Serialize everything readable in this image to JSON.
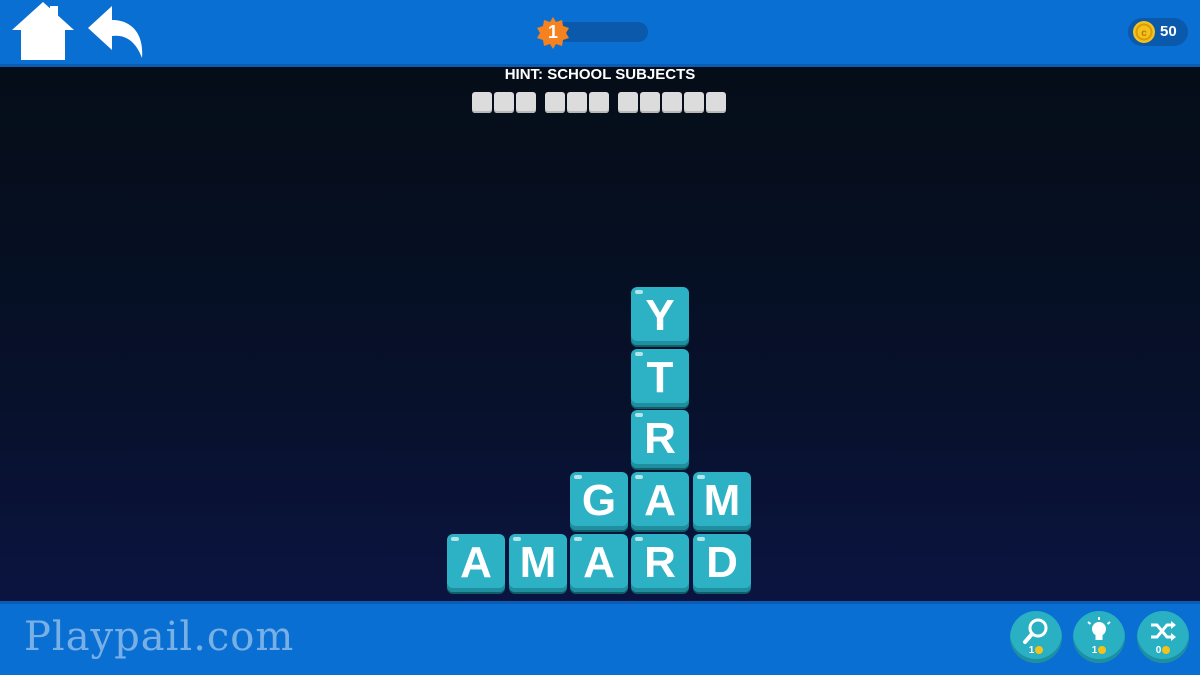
{
  "header": {
    "home_icon": "home-icon",
    "back_icon": "undo-arrow-icon",
    "level": "1",
    "coins": "50",
    "colors": {
      "bar": "#0a6fd2",
      "badge": "#f5821f",
      "coin": "#f5c21b"
    }
  },
  "puzzle": {
    "hint": "HINT: SCHOOL SUBJECTS",
    "answer_slots": [
      3,
      3,
      5
    ],
    "tiles": [
      {
        "letter": "Y"
      },
      {
        "letter": "T"
      },
      {
        "letter": "R"
      },
      {
        "letter": "G"
      },
      {
        "letter": "A"
      },
      {
        "letter": "M"
      },
      {
        "letter": "A"
      },
      {
        "letter": "M"
      },
      {
        "letter": "A"
      },
      {
        "letter": "R"
      },
      {
        "letter": "D"
      }
    ],
    "tile_color": "#2db1c4"
  },
  "footer": {
    "watermark": "Playpail.com",
    "powerups": [
      {
        "icon": "magnifier-icon",
        "cost": "1"
      },
      {
        "icon": "lightbulb-icon",
        "cost": "1"
      },
      {
        "icon": "shuffle-icon",
        "cost": "0"
      }
    ]
  }
}
